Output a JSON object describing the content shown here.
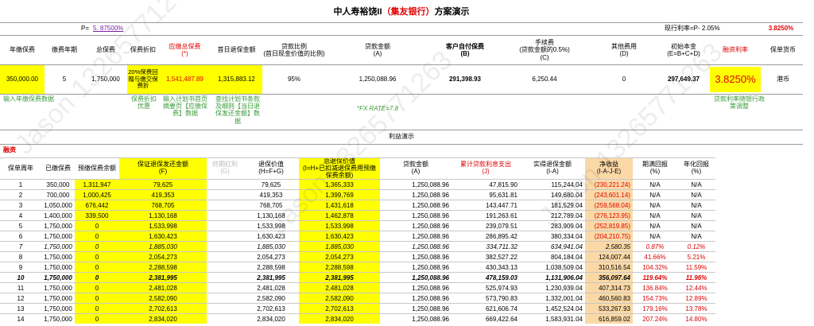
{
  "title_prefix": "中人寿裕饶II",
  "title_bank": "（集友银行）",
  "title_suffix": "方案演示",
  "p_label": "P=",
  "p_value": "5. 87500%",
  "rate_label": "现行利率=P- 2.05%",
  "rate_value": "3.8250%",
  "headers": {
    "annual": "年缴保费",
    "period": "缴费年期",
    "total": "总保费",
    "discount": "保费折扣",
    "payable": "应缴总保费\n(*)",
    "day1": "首日退保金额",
    "loan_ratio": "贷款比例\n(首日现金价值的比例)",
    "loan_amt": "贷款金额\n(A)",
    "self_pay": "客户自付保费\n(B)",
    "fee": "手续费\n(贷款金额的0.5%)\n(C)",
    "other": "其他费用\n(D)",
    "initial": "初始本金\n(E=B+C+D)",
    "fin_rate": "融资利率",
    "currency": "保单货币"
  },
  "values": {
    "annual": "350,000.00",
    "period": "5",
    "total": "1,750,000",
    "discount": "20%保费回赠与缴交保费折",
    "payable": "1,541,487.89",
    "day1": "1,315,883.12",
    "loan_ratio": "95%",
    "loan_amt": "1,250,088.96",
    "self_pay": "291,398.93",
    "fee": "6,250.44",
    "other": "0",
    "initial": "297,649.37",
    "fin_rate": "3.8250%",
    "currency": "港币"
  },
  "notes": {
    "n1": "输入年缴保费数据",
    "n2": "保费折扣优惠",
    "n3": "输入计划书首页摘要页【应缴保费】数据",
    "n4": "查找计划书条款及细则【当日退保发还金额】数据",
    "n5": "*FX RATE=7.8",
    "n6": "贷款利率随银行政策调整"
  },
  "section_label": "利益演示",
  "finance_label": "融资",
  "table_headers": [
    "保单周年",
    "已缴保费",
    "预缴保费余额",
    "保证退保发还金额\n(F)",
    "终期红利\n(G)",
    "退保价值\n(H=F+G)",
    "总退保价值\n(I=H+已扣减退保费用预缴保费余额)",
    "贷款金额\n(A)",
    "累计贷款利息支出\n(J)",
    "实得退保金额\n(I-A)",
    "净收益\n(I-A-J-E)",
    "期满回报\n(%)",
    "年化回报\n(%)"
  ],
  "rows": [
    [
      "1",
      "350,000",
      "1,311,947",
      "79,625",
      "",
      "79,625",
      "1,365,333",
      "1,250,088.96",
      "47,815.90",
      "115,244.04",
      "(230,221.24)",
      "N/A",
      "N/A"
    ],
    [
      "2",
      "700,000",
      "1,000,425",
      "419,353",
      "",
      "419,353",
      "1,399,769",
      "1,250,088.96",
      "95,631.81",
      "149,680.04",
      "(243,601.14)",
      "N/A",
      "N/A"
    ],
    [
      "3",
      "1,050,000",
      "676,442",
      "768,705",
      "",
      "768,705",
      "1,431,618",
      "1,250,088.96",
      "143,447.71",
      "181,529.04",
      "(259,568.04)",
      "N/A",
      "N/A"
    ],
    [
      "4",
      "1,400,000",
      "339,500",
      "1,130,168",
      "",
      "1,130,168",
      "1,462,878",
      "1,250,088.96",
      "191,263.61",
      "212,789.04",
      "(276,123.95)",
      "N/A",
      "N/A"
    ],
    [
      "5",
      "1,750,000",
      "0",
      "1,533,998",
      "",
      "1,533,998",
      "1,533,998",
      "1,250,088.96",
      "239,079.51",
      "283,909.04",
      "(252,819.85)",
      "N/A",
      "N/A"
    ],
    [
      "6",
      "1,750,000",
      "0",
      "1,630,423",
      "",
      "1,630,423",
      "1,630,423",
      "1,250,088.96",
      "286,895.42",
      "380,334.04",
      "(204,210.75)",
      "N/A",
      "N/A"
    ],
    [
      "7",
      "1,750,000",
      "0",
      "1,885,030",
      "",
      "1,885,030",
      "1,885,030",
      "1,250,088.96",
      "334,711.32",
      "634,941.04",
      "2,580.35",
      "0.87%",
      "0.12%"
    ],
    [
      "8",
      "1,750,000",
      "0",
      "2,054,273",
      "",
      "2,054,273",
      "2,054,273",
      "1,250,088.96",
      "382,527.22",
      "804,184.04",
      "124,007.44",
      "41.66%",
      "5.21%"
    ],
    [
      "9",
      "1,750,000",
      "0",
      "2,288,598",
      "",
      "2,288,598",
      "2,288,598",
      "1,250,088.96",
      "430,343.13",
      "1,038,509.04",
      "310,516.54",
      "104.32%",
      "11.59%"
    ],
    [
      "10",
      "1,750,000",
      "0",
      "2,381,995",
      "",
      "2,381,995",
      "2,381,995",
      "1,250,088.96",
      "478,159.03",
      "1,131,906.04",
      "356,097.64",
      "119.64%",
      "11.96%"
    ],
    [
      "11",
      "1,750,000",
      "0",
      "2,481,028",
      "",
      "2,481,028",
      "2,481,028",
      "1,250,088.96",
      "525,974.93",
      "1,230,939.04",
      "407,314.73",
      "136.84%",
      "12.44%"
    ],
    [
      "12",
      "1,750,000",
      "0",
      "2,582,090",
      "",
      "2,582,090",
      "2,582,090",
      "1,250,088.96",
      "573,790.83",
      "1,332,001.04",
      "460,560.83",
      "154.73%",
      "12.89%"
    ],
    [
      "13",
      "1,750,000",
      "0",
      "2,702,613",
      "",
      "2,702,613",
      "2,702,613",
      "1,250,088.96",
      "621,606.74",
      "1,452,524.04",
      "533,267.93",
      "179.16%",
      "13.78%"
    ],
    [
      "14",
      "1,750,000",
      "0",
      "2,834,020",
      "",
      "2,834,020",
      "2,834,020",
      "1,250,088.96",
      "669,422.64",
      "1,583,931.04",
      "616,859.02",
      "207.24%",
      "14.80%"
    ]
  ],
  "row_styles": [
    "n",
    "n",
    "n",
    "n",
    "n",
    "n",
    "i",
    "n",
    "n",
    "b",
    "n",
    "n",
    "n",
    "n"
  ],
  "watermark": "Jason 13265771263"
}
